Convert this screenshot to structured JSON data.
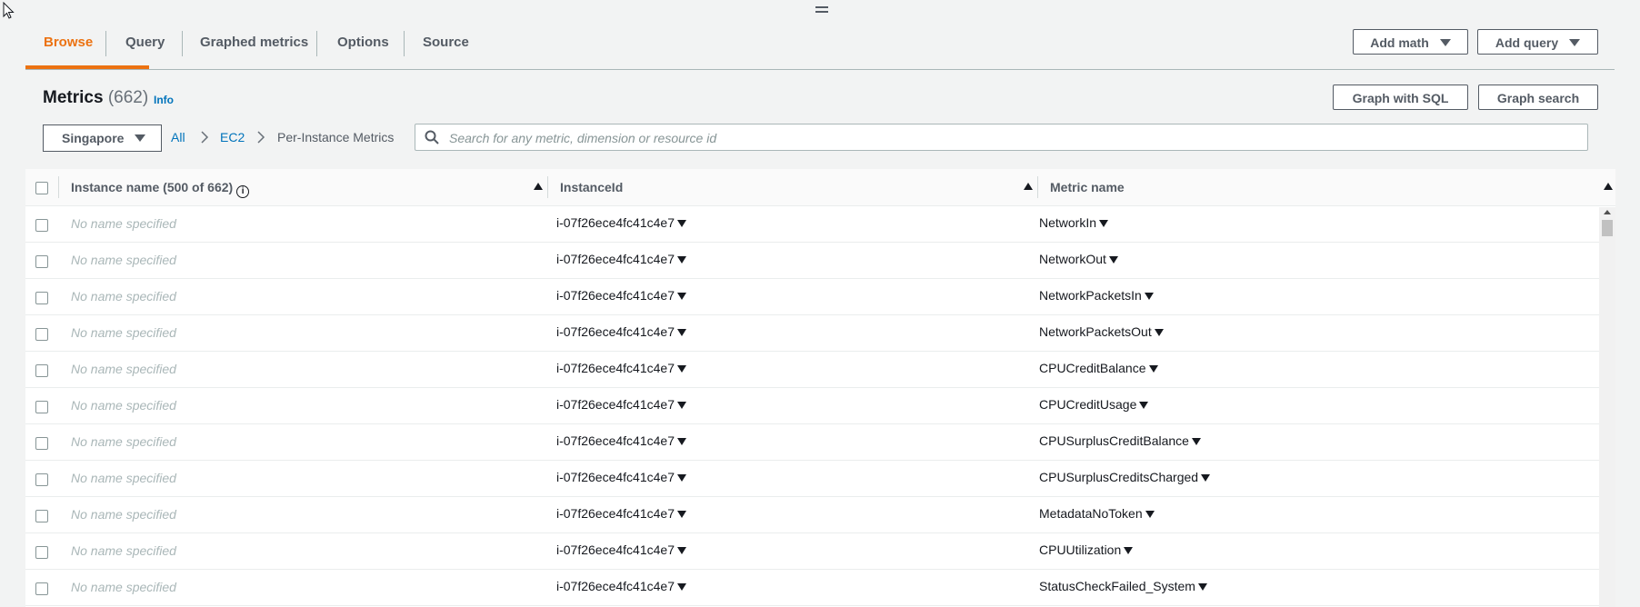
{
  "tabs": [
    {
      "label": "Browse",
      "active": true
    },
    {
      "label": "Query"
    },
    {
      "label": "Graphed metrics"
    },
    {
      "label": "Options"
    },
    {
      "label": "Source"
    }
  ],
  "toolbar": {
    "add_math": "Add math",
    "add_query": "Add query"
  },
  "panel": {
    "title": "Metrics",
    "count": "(662)",
    "info": "Info",
    "graph_sql": "Graph with SQL",
    "graph_search": "Graph search"
  },
  "region": "Singapore",
  "breadcrumb": [
    "All",
    "EC2",
    "Per-Instance Metrics"
  ],
  "search": {
    "placeholder": "Search for any metric, dimension or resource id"
  },
  "table": {
    "columns": [
      "Instance name (500 of 662)",
      "InstanceId",
      "Metric name"
    ],
    "rows": [
      {
        "name": "No name specified",
        "id": "i-07f26ece4fc41c4e7",
        "metric": "NetworkIn"
      },
      {
        "name": "No name specified",
        "id": "i-07f26ece4fc41c4e7",
        "metric": "NetworkOut"
      },
      {
        "name": "No name specified",
        "id": "i-07f26ece4fc41c4e7",
        "metric": "NetworkPacketsIn"
      },
      {
        "name": "No name specified",
        "id": "i-07f26ece4fc41c4e7",
        "metric": "NetworkPacketsOut"
      },
      {
        "name": "No name specified",
        "id": "i-07f26ece4fc41c4e7",
        "metric": "CPUCreditBalance"
      },
      {
        "name": "No name specified",
        "id": "i-07f26ece4fc41c4e7",
        "metric": "CPUCreditUsage"
      },
      {
        "name": "No name specified",
        "id": "i-07f26ece4fc41c4e7",
        "metric": "CPUSurplusCreditBalance"
      },
      {
        "name": "No name specified",
        "id": "i-07f26ece4fc41c4e7",
        "metric": "CPUSurplusCreditsCharged"
      },
      {
        "name": "No name specified",
        "id": "i-07f26ece4fc41c4e7",
        "metric": "MetadataNoToken"
      },
      {
        "name": "No name specified",
        "id": "i-07f26ece4fc41c4e7",
        "metric": "CPUUtilization"
      },
      {
        "name": "No name specified",
        "id": "i-07f26ece4fc41c4e7",
        "metric": "StatusCheckFailed_System"
      }
    ]
  },
  "colors": {
    "accent": "#ec7211",
    "link": "#0073bb",
    "text": "#16191f",
    "muted": "#aab7b8"
  },
  "icons": [
    "cursor-icon",
    "drag-handle-icon",
    "caret-down-icon",
    "search-icon",
    "info-icon",
    "sort-ascending-icon",
    "dropdown-icon"
  ]
}
